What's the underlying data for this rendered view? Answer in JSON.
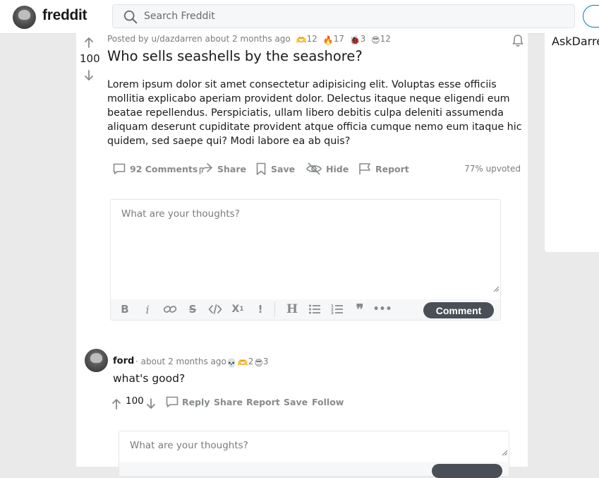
{
  "header": {
    "logo_text": "freddit",
    "search_placeholder": "Search Freddit"
  },
  "sidebar": {
    "community_title": "AskDarre"
  },
  "post": {
    "score": "100",
    "meta_prefix": "Posted by u/dazdarren about 2 months ago",
    "awards": [
      {
        "icon": "heart-hands",
        "count": "12"
      },
      {
        "icon": "fire",
        "count": "17"
      },
      {
        "icon": "bug",
        "count": "3"
      },
      {
        "icon": "sunglasses-face",
        "count": "12"
      }
    ],
    "title": "Who sells seashells by the seashore?",
    "body": "Lorem ipsum dolor sit amet consectetur adipisicing elit. Voluptas esse officiis mollitia explicabo aperiam provident dolor. Delectus itaque neque eligendi eum beatae repellendus. Perspiciatis, ullam libero debitis culpa deleniti assumenda aliquam deserunt cupiditate provident atque officia cumque nemo eum itaque hic quidem, sed saepe qui? Modi labore ea ab quis?",
    "actions": {
      "comments": "92 Comments",
      "share": "Share",
      "save": "Save",
      "hide": "Hide",
      "report": "Report"
    },
    "upvoted": "77% upvoted"
  },
  "comment_box": {
    "placeholder": "What are your thoughts?",
    "submit_label": "Comment"
  },
  "comment": {
    "author": "ford",
    "meta": "· about 2 months ago",
    "awards": [
      {
        "icon": "skull",
        "count": ""
      },
      {
        "icon": "heart-hands",
        "count": "2"
      },
      {
        "icon": "sunglasses-face",
        "count": "3"
      }
    ],
    "text": "what's good?",
    "score": "100",
    "actions": {
      "reply": "Reply",
      "share": "Share",
      "report": "Report",
      "save": "Save",
      "follow": "Follow"
    }
  },
  "reply_box": {
    "placeholder": "What are your thoughts?"
  },
  "colors": {
    "accent": "#0079d3",
    "comment_button": "#4a4f57",
    "muted_text": "#878a8c"
  }
}
